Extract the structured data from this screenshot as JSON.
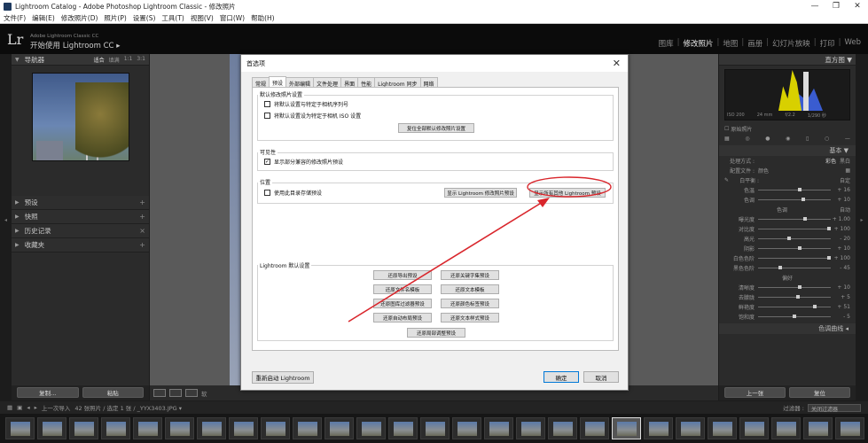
{
  "window": {
    "title": "Lightroom Catalog - Adobe Photoshop Lightroom Classic - 修改照片",
    "controls": [
      "—",
      "❐",
      "✕"
    ]
  },
  "menubar": [
    "文件(F)",
    "编辑(E)",
    "修改照片(D)",
    "照片(P)",
    "设置(S)",
    "工具(T)",
    "视图(V)",
    "窗口(W)",
    "帮助(H)"
  ],
  "identity": {
    "logo": "Lr",
    "small": "Adobe Lightroom Classic CC",
    "big": "开始使用 Lightroom CC",
    "arrow": "▸"
  },
  "modules": {
    "items": [
      "图库",
      "修改照片",
      "地图",
      "画册",
      "幻灯片放映",
      "打印",
      "Web"
    ],
    "active": "修改照片"
  },
  "left_panel": {
    "navigator": {
      "title": "导航器",
      "options": [
        "适合",
        "填满",
        "1:1",
        "3:1"
      ]
    },
    "sections": [
      "预设",
      "快照",
      "历史记录",
      "收藏夹"
    ],
    "buttons": {
      "copy": "复制...",
      "paste": "粘贴"
    }
  },
  "right_panel": {
    "histogram_title": "直方图",
    "histogram_ticks": [
      "ISO 200",
      "24 mm",
      "f/2.2",
      "1/290 秒"
    ],
    "original_photo": "原始照片",
    "basic_title": "基本",
    "treatment_label": "处理方式 :",
    "treatment_options": [
      "彩色",
      "黑白"
    ],
    "profile_label": "配置文件 :",
    "profile_value": "颜色",
    "wb_label": "白平衡 :",
    "wb_value": "自定",
    "sliders_wb": [
      {
        "label": "色温",
        "value": "+ 16",
        "pos": 0.55
      },
      {
        "label": "色调",
        "value": "+ 10",
        "pos": 0.6
      }
    ],
    "tone_title": "色调",
    "tone_auto": "自动",
    "sliders_tone": [
      {
        "label": "曝光度",
        "value": "+ 1.00",
        "pos": 0.62
      },
      {
        "label": "对比度",
        "value": "+ 100",
        "pos": 0.95
      },
      {
        "label": "高光",
        "value": "- 20",
        "pos": 0.4
      },
      {
        "label": "阴影",
        "value": "+ 10",
        "pos": 0.55
      },
      {
        "label": "白色色阶",
        "value": "+ 100",
        "pos": 0.95
      },
      {
        "label": "黑色色阶",
        "value": "- 45",
        "pos": 0.28
      }
    ],
    "presence_title": "偏好",
    "sliders_presence": [
      {
        "label": "清晰度",
        "value": "+ 10",
        "pos": 0.55
      },
      {
        "label": "去朦胧",
        "value": "+ 5",
        "pos": 0.52
      },
      {
        "label": "鲜艳度",
        "value": "+ 51",
        "pos": 0.75
      },
      {
        "label": "饱和度",
        "value": "- 5",
        "pos": 0.48
      }
    ],
    "tone_curve": "色调曲线",
    "buttons": {
      "prev": "上一张",
      "reset": "复位"
    }
  },
  "toolbar": {
    "soft_proof": "软"
  },
  "filmstrip_bar": {
    "nav": "1 2",
    "source": "上一次导入",
    "count": "42 张照片 / 选定 1 张 / _YYX3403.JPG ▾",
    "filter_label": "过滤器 :",
    "filter_value": "关闭过滤器"
  },
  "dialog": {
    "title": "首选项",
    "close": "✕",
    "tabs": [
      "常规",
      "预设",
      "外部编辑",
      "文件处理",
      "界面",
      "性能",
      "Lightroom 同步",
      "网络"
    ],
    "active_tab": "预设",
    "group_default": {
      "label": "默认修改照片设置",
      "cb1": "将默认设置与特定于相机序列号",
      "cb2": "将默认设置设为特定于相机 ISO 设置",
      "reset_button": "复位全部默认修改照片设置"
    },
    "group_visibility": {
      "label": "可见性",
      "cb": "显示部分兼容的修改照片预设",
      "checked": "✓"
    },
    "group_location": {
      "label": "位置",
      "cb": "使用此目录存储预设",
      "show_dev_presets": "显示 Lightroom 修改照片预设",
      "show_all_presets": "显示所有其他 Lightroom 预设"
    },
    "group_defaults": {
      "label": "Lightroom 默认设置",
      "buttons_left": [
        "还原导出预设",
        "还原文件名模板",
        "还原图库过滤器预设",
        "还原自动布局预设"
      ],
      "buttons_right": [
        "还原关键字集预设",
        "还原文本模板",
        "还原颜色标签预设",
        "还原文本样式预设"
      ],
      "button_bottom": "还原局部调整预设"
    },
    "restart_button": "重新启动 Lightroom",
    "ok_button": "确定",
    "cancel_button": "取消"
  },
  "colors": {
    "annotation": "#d9262c",
    "accent": "#0078d7"
  }
}
